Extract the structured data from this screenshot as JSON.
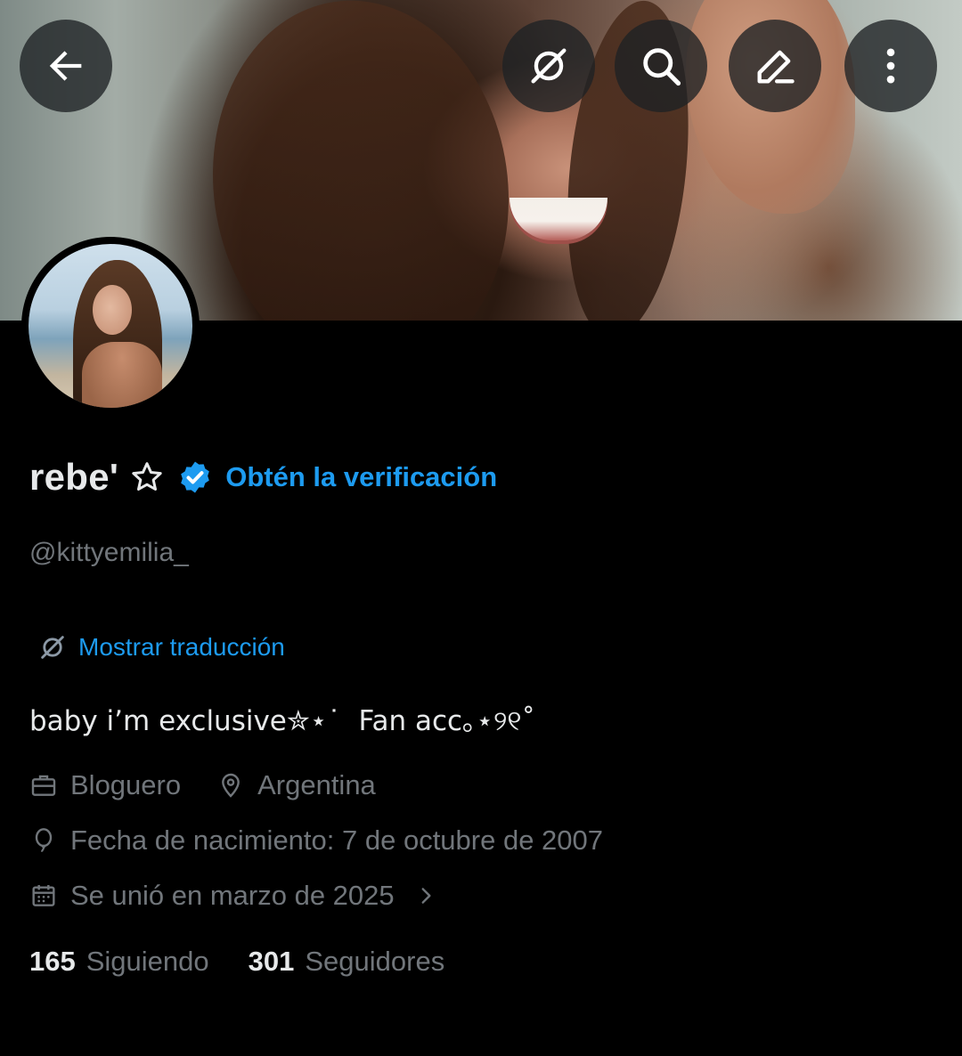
{
  "header": {
    "back_icon": "arrow-left-icon",
    "translate_icon": "translate-icon",
    "search_icon": "search-icon",
    "edit_icon": "edit-pencil-icon",
    "more_icon": "more-vertical-icon"
  },
  "profile": {
    "display_name": "rebe'",
    "name_symbol": "star-outline-icon",
    "verified_icon": "verified-badge-icon",
    "get_verified_label": "Obtén la verificación",
    "handle": "@kittyemilia_",
    "translate_label": "Mostrar traducción",
    "bio": "baby i’m exclusive✮⋆˙  Fan acc｡⋆୨୧˚",
    "work": "Bloguero",
    "location": "Argentina",
    "birth": "Fecha de nacimiento: 7 de octubre de 2007",
    "joined": "Se unió en marzo de 2025"
  },
  "stats": {
    "following_count": "165",
    "following_label": "Siguiendo",
    "followers_count": "301",
    "followers_label": "Seguidores"
  },
  "colors": {
    "accent": "#1d9bf0",
    "muted": "#71767b",
    "text": "#e7e9ea",
    "background": "#000000"
  }
}
